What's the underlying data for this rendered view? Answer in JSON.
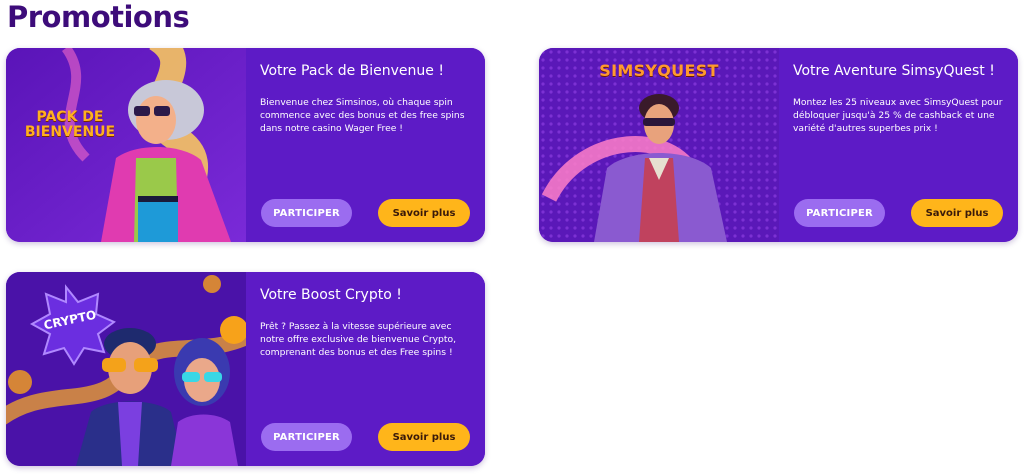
{
  "page": {
    "title": "Promotions"
  },
  "colors": {
    "title": "#3d0c7a",
    "card_bg": "#5d1bc6",
    "participate_button": "#9b6cf0",
    "more_button": "#ffb51a"
  },
  "cards": [
    {
      "art_label": "PACK DE BIENVENUE",
      "title": "Votre Pack de Bienvenue !",
      "text": "Bienvenue chez Simsinos, où chaque spin commence avec des bonus et des free spins dans notre casino Wager Free !",
      "participate_label": "PARTICIPER",
      "more_label": "Savoir plus"
    },
    {
      "art_label": "SIMSYQUEST",
      "title": "Votre Aventure SimsyQuest !",
      "text": "Montez les 25 niveaux avec SimsyQuest pour débloquer jusqu'à 25 % de cashback et une variété d'autres superbes prix !",
      "participate_label": "PARTICIPER",
      "more_label": "Savoir plus"
    },
    {
      "art_label": "CRYPTO",
      "title": "Votre Boost Crypto !",
      "text": "Prêt ? Passez à la vitesse supérieure avec notre offre exclusive de bienvenue Crypto, comprenant des bonus et des Free spins !",
      "participate_label": "PARTICIPER",
      "more_label": "Savoir plus"
    }
  ]
}
